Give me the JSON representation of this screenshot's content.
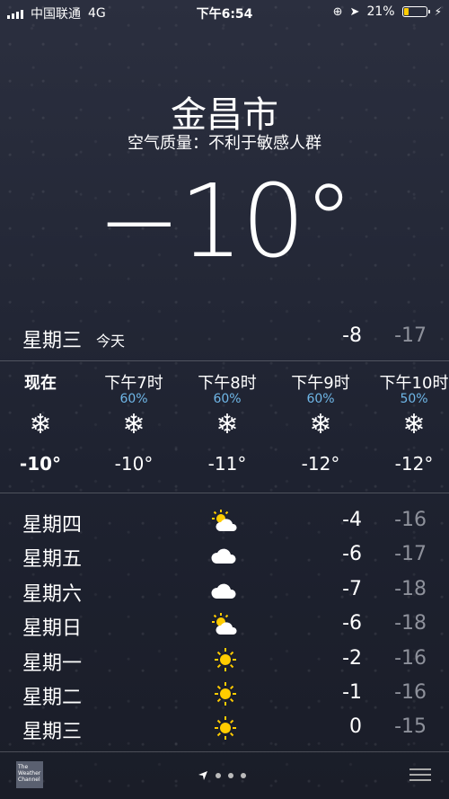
{
  "status_bar": {
    "carrier": "中国联通",
    "network": "4G",
    "time": "下午6:54",
    "battery_percent": "21%",
    "battery_level": 0.21
  },
  "location": {
    "city": "金昌市",
    "air_quality": "空气质量：不利于敏感人群",
    "current_temp": "−10°"
  },
  "today": {
    "day": "星期三",
    "tag": "今天",
    "high": "-8",
    "low": "-17"
  },
  "hourly": [
    {
      "label": "现在",
      "precip": "",
      "icon": "snowflake-icon",
      "temp": "-10°"
    },
    {
      "label": "下午7时",
      "precip": "60%",
      "icon": "snowflake-icon",
      "temp": "-10°"
    },
    {
      "label": "下午8时",
      "precip": "60%",
      "icon": "snowflake-icon",
      "temp": "-11°"
    },
    {
      "label": "下午9时",
      "precip": "60%",
      "icon": "snowflake-icon",
      "temp": "-12°"
    },
    {
      "label": "下午10时",
      "precip": "50%",
      "icon": "snowflake-icon",
      "temp": "-12°"
    }
  ],
  "daily": [
    {
      "day": "星期四",
      "icon": "partly-cloudy-icon",
      "high": "-4",
      "low": "-16"
    },
    {
      "day": "星期五",
      "icon": "cloud-icon",
      "high": "-6",
      "low": "-17"
    },
    {
      "day": "星期六",
      "icon": "cloud-icon",
      "high": "-7",
      "low": "-18"
    },
    {
      "day": "星期日",
      "icon": "partly-cloudy-icon",
      "high": "-6",
      "low": "-18"
    },
    {
      "day": "星期一",
      "icon": "sun-icon",
      "high": "-2",
      "low": "-16"
    },
    {
      "day": "星期二",
      "icon": "sun-icon",
      "high": "-1",
      "low": "-16"
    },
    {
      "day": "星期三",
      "icon": "sun-icon",
      "high": "0",
      "low": "-15"
    }
  ],
  "bottom_bar": {
    "logo_text": "The Weather Channel",
    "page_dots": 3
  },
  "colors": {
    "precip": "#6fb7e8",
    "low_temp": "#8e919b",
    "sun": "#ffcc00",
    "battery": "#ffcc00"
  }
}
